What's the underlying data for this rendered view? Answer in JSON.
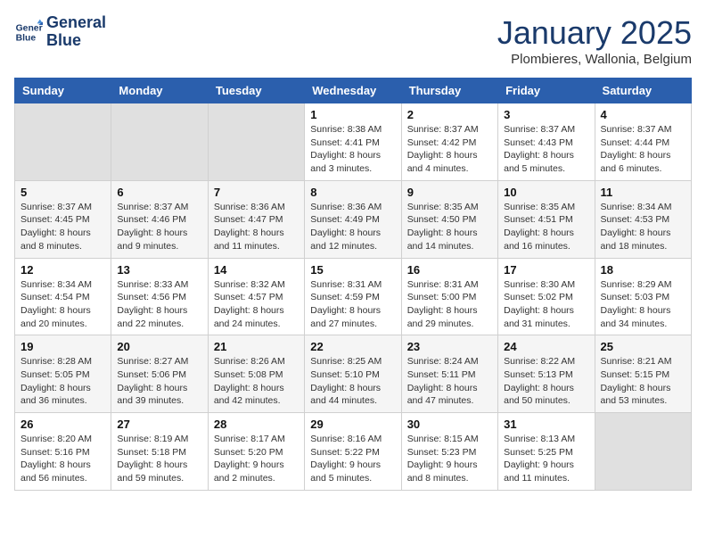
{
  "header": {
    "logo_line1": "General",
    "logo_line2": "Blue",
    "month_title": "January 2025",
    "location": "Plombieres, Wallonia, Belgium"
  },
  "weekdays": [
    "Sunday",
    "Monday",
    "Tuesday",
    "Wednesday",
    "Thursday",
    "Friday",
    "Saturday"
  ],
  "weeks": [
    [
      {
        "day": "",
        "sunrise": "",
        "sunset": "",
        "daylight": "",
        "empty": true
      },
      {
        "day": "",
        "sunrise": "",
        "sunset": "",
        "daylight": "",
        "empty": true
      },
      {
        "day": "",
        "sunrise": "",
        "sunset": "",
        "daylight": "",
        "empty": true
      },
      {
        "day": "1",
        "sunrise": "Sunrise: 8:38 AM",
        "sunset": "Sunset: 4:41 PM",
        "daylight": "Daylight: 8 hours and 3 minutes."
      },
      {
        "day": "2",
        "sunrise": "Sunrise: 8:37 AM",
        "sunset": "Sunset: 4:42 PM",
        "daylight": "Daylight: 8 hours and 4 minutes."
      },
      {
        "day": "3",
        "sunrise": "Sunrise: 8:37 AM",
        "sunset": "Sunset: 4:43 PM",
        "daylight": "Daylight: 8 hours and 5 minutes."
      },
      {
        "day": "4",
        "sunrise": "Sunrise: 8:37 AM",
        "sunset": "Sunset: 4:44 PM",
        "daylight": "Daylight: 8 hours and 6 minutes."
      }
    ],
    [
      {
        "day": "5",
        "sunrise": "Sunrise: 8:37 AM",
        "sunset": "Sunset: 4:45 PM",
        "daylight": "Daylight: 8 hours and 8 minutes."
      },
      {
        "day": "6",
        "sunrise": "Sunrise: 8:37 AM",
        "sunset": "Sunset: 4:46 PM",
        "daylight": "Daylight: 8 hours and 9 minutes."
      },
      {
        "day": "7",
        "sunrise": "Sunrise: 8:36 AM",
        "sunset": "Sunset: 4:47 PM",
        "daylight": "Daylight: 8 hours and 11 minutes."
      },
      {
        "day": "8",
        "sunrise": "Sunrise: 8:36 AM",
        "sunset": "Sunset: 4:49 PM",
        "daylight": "Daylight: 8 hours and 12 minutes."
      },
      {
        "day": "9",
        "sunrise": "Sunrise: 8:35 AM",
        "sunset": "Sunset: 4:50 PM",
        "daylight": "Daylight: 8 hours and 14 minutes."
      },
      {
        "day": "10",
        "sunrise": "Sunrise: 8:35 AM",
        "sunset": "Sunset: 4:51 PM",
        "daylight": "Daylight: 8 hours and 16 minutes."
      },
      {
        "day": "11",
        "sunrise": "Sunrise: 8:34 AM",
        "sunset": "Sunset: 4:53 PM",
        "daylight": "Daylight: 8 hours and 18 minutes."
      }
    ],
    [
      {
        "day": "12",
        "sunrise": "Sunrise: 8:34 AM",
        "sunset": "Sunset: 4:54 PM",
        "daylight": "Daylight: 8 hours and 20 minutes."
      },
      {
        "day": "13",
        "sunrise": "Sunrise: 8:33 AM",
        "sunset": "Sunset: 4:56 PM",
        "daylight": "Daylight: 8 hours and 22 minutes."
      },
      {
        "day": "14",
        "sunrise": "Sunrise: 8:32 AM",
        "sunset": "Sunset: 4:57 PM",
        "daylight": "Daylight: 8 hours and 24 minutes."
      },
      {
        "day": "15",
        "sunrise": "Sunrise: 8:31 AM",
        "sunset": "Sunset: 4:59 PM",
        "daylight": "Daylight: 8 hours and 27 minutes."
      },
      {
        "day": "16",
        "sunrise": "Sunrise: 8:31 AM",
        "sunset": "Sunset: 5:00 PM",
        "daylight": "Daylight: 8 hours and 29 minutes."
      },
      {
        "day": "17",
        "sunrise": "Sunrise: 8:30 AM",
        "sunset": "Sunset: 5:02 PM",
        "daylight": "Daylight: 8 hours and 31 minutes."
      },
      {
        "day": "18",
        "sunrise": "Sunrise: 8:29 AM",
        "sunset": "Sunset: 5:03 PM",
        "daylight": "Daylight: 8 hours and 34 minutes."
      }
    ],
    [
      {
        "day": "19",
        "sunrise": "Sunrise: 8:28 AM",
        "sunset": "Sunset: 5:05 PM",
        "daylight": "Daylight: 8 hours and 36 minutes."
      },
      {
        "day": "20",
        "sunrise": "Sunrise: 8:27 AM",
        "sunset": "Sunset: 5:06 PM",
        "daylight": "Daylight: 8 hours and 39 minutes."
      },
      {
        "day": "21",
        "sunrise": "Sunrise: 8:26 AM",
        "sunset": "Sunset: 5:08 PM",
        "daylight": "Daylight: 8 hours and 42 minutes."
      },
      {
        "day": "22",
        "sunrise": "Sunrise: 8:25 AM",
        "sunset": "Sunset: 5:10 PM",
        "daylight": "Daylight: 8 hours and 44 minutes."
      },
      {
        "day": "23",
        "sunrise": "Sunrise: 8:24 AM",
        "sunset": "Sunset: 5:11 PM",
        "daylight": "Daylight: 8 hours and 47 minutes."
      },
      {
        "day": "24",
        "sunrise": "Sunrise: 8:22 AM",
        "sunset": "Sunset: 5:13 PM",
        "daylight": "Daylight: 8 hours and 50 minutes."
      },
      {
        "day": "25",
        "sunrise": "Sunrise: 8:21 AM",
        "sunset": "Sunset: 5:15 PM",
        "daylight": "Daylight: 8 hours and 53 minutes."
      }
    ],
    [
      {
        "day": "26",
        "sunrise": "Sunrise: 8:20 AM",
        "sunset": "Sunset: 5:16 PM",
        "daylight": "Daylight: 8 hours and 56 minutes."
      },
      {
        "day": "27",
        "sunrise": "Sunrise: 8:19 AM",
        "sunset": "Sunset: 5:18 PM",
        "daylight": "Daylight: 8 hours and 59 minutes."
      },
      {
        "day": "28",
        "sunrise": "Sunrise: 8:17 AM",
        "sunset": "Sunset: 5:20 PM",
        "daylight": "Daylight: 9 hours and 2 minutes."
      },
      {
        "day": "29",
        "sunrise": "Sunrise: 8:16 AM",
        "sunset": "Sunset: 5:22 PM",
        "daylight": "Daylight: 9 hours and 5 minutes."
      },
      {
        "day": "30",
        "sunrise": "Sunrise: 8:15 AM",
        "sunset": "Sunset: 5:23 PM",
        "daylight": "Daylight: 9 hours and 8 minutes."
      },
      {
        "day": "31",
        "sunrise": "Sunrise: 8:13 AM",
        "sunset": "Sunset: 5:25 PM",
        "daylight": "Daylight: 9 hours and 11 minutes."
      },
      {
        "day": "",
        "sunrise": "",
        "sunset": "",
        "daylight": "",
        "empty": true
      }
    ]
  ]
}
